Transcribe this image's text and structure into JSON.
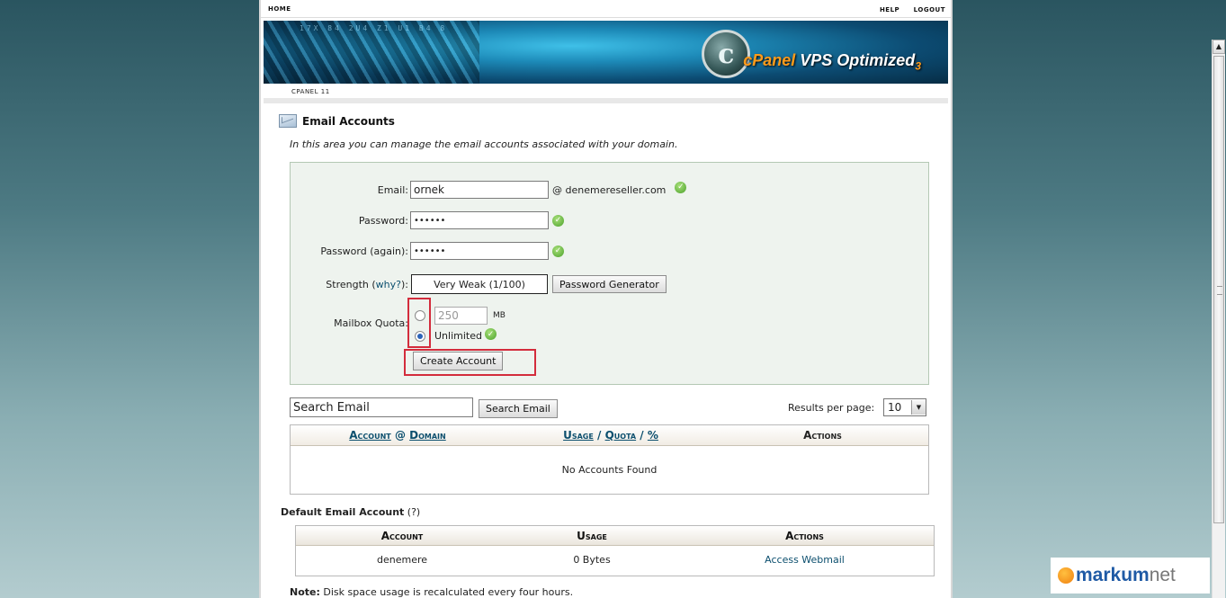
{
  "topnav": {
    "home": "HOME",
    "help": "HELP",
    "logout": "LOGOUT"
  },
  "banner": {
    "logo_letter": "c",
    "logo_brand": "cPanel",
    "logo_product": "VPS Optimized",
    "logo_version": "3",
    "digits": "17X  84  2U4  Z1  U1  B4 8"
  },
  "breadcrumb": "CPANEL 11",
  "page": {
    "title": "Email Accounts",
    "intro": "In this area you can manage the email accounts associated with your domain."
  },
  "form": {
    "email_label": "Email:",
    "email_value": "ornek",
    "domain": "@ denemereseller.com",
    "password_label": "Password:",
    "password_value": "••••••",
    "password_again_label": "Password (again):",
    "password_again_value": "••••••",
    "strength_label": "Strength (",
    "strength_link": "why?",
    "strength_label_end": "):",
    "strength_value": "Very Weak (1/100)",
    "password_generator": "Password Generator",
    "quota_label": "Mailbox Quota:",
    "quota_value": "250",
    "quota_unit": "MB",
    "quota_unlimited": "Unlimited",
    "create_button": "Create Account"
  },
  "search": {
    "placeholder": "Search Email",
    "button": "Search Email",
    "results_label": "Results per page:",
    "results_value": "10"
  },
  "accounts_table": {
    "col_account": "Account",
    "col_at": "@",
    "col_domain": "Domain",
    "col_usage": "Usage",
    "col_slash1": "/",
    "col_quota": "Quota",
    "col_slash2": "/",
    "col_percent": "%",
    "col_actions": "Actions",
    "empty": "No Accounts Found"
  },
  "default_account": {
    "title": "Default Email Account",
    "help": "(?)",
    "col_account": "Account",
    "col_usage": "Usage",
    "col_actions": "Actions",
    "account": "denemere",
    "usage": "0 Bytes",
    "action": "Access Webmail"
  },
  "note": {
    "label": "Note:",
    "text": " Disk space usage is recalculated every four hours."
  },
  "watermark": {
    "part1": "markum",
    "part2": "net"
  },
  "colors": {
    "highlight": "#d32c3c",
    "link": "#0c4f6e",
    "form_bg": "#eef3ee"
  },
  "icons": [
    "envelope-icon",
    "checkmark-icon",
    "dropdown-arrow-icon",
    "markum-logo-icon"
  ]
}
